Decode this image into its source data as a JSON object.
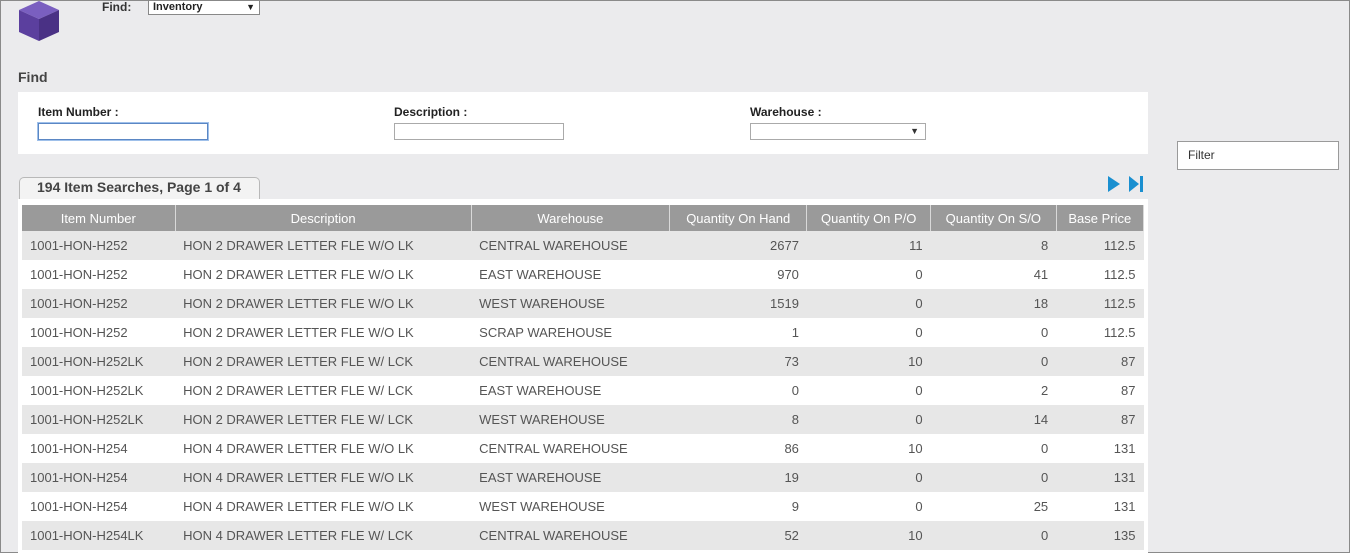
{
  "header": {
    "find_label": "Find:",
    "find_select": "Inventory"
  },
  "section": {
    "title": "Find"
  },
  "form": {
    "item_number_label": "Item Number :",
    "item_number_value": "",
    "description_label": "Description :",
    "description_value": "",
    "warehouse_label": "Warehouse :",
    "warehouse_value": ""
  },
  "filter": {
    "label": "Filter"
  },
  "results": {
    "tab_label": "194 Item Searches, Page 1 of 4",
    "columns": [
      "Item Number",
      "Description",
      "Warehouse",
      "Quantity On Hand",
      "Quantity On P/O",
      "Quantity On S/O",
      "Base Price"
    ],
    "rows": [
      [
        "1001-HON-H252",
        "HON 2 DRAWER LETTER FLE W/O LK",
        "CENTRAL WAREHOUSE",
        "2677",
        "11",
        "8",
        "112.5"
      ],
      [
        "1001-HON-H252",
        "HON 2 DRAWER LETTER FLE W/O LK",
        "EAST WAREHOUSE",
        "970",
        "0",
        "41",
        "112.5"
      ],
      [
        "1001-HON-H252",
        "HON 2 DRAWER LETTER FLE W/O LK",
        "WEST WAREHOUSE",
        "1519",
        "0",
        "18",
        "112.5"
      ],
      [
        "1001-HON-H252",
        "HON 2 DRAWER LETTER FLE W/O LK",
        "SCRAP WAREHOUSE",
        "1",
        "0",
        "0",
        "112.5"
      ],
      [
        "1001-HON-H252LK",
        "HON 2 DRAWER LETTER FLE W/ LCK",
        "CENTRAL WAREHOUSE",
        "73",
        "10",
        "0",
        "87"
      ],
      [
        "1001-HON-H252LK",
        "HON 2 DRAWER LETTER FLE W/ LCK",
        "EAST WAREHOUSE",
        "0",
        "0",
        "2",
        "87"
      ],
      [
        "1001-HON-H252LK",
        "HON 2 DRAWER LETTER FLE W/ LCK",
        "WEST WAREHOUSE",
        "8",
        "0",
        "14",
        "87"
      ],
      [
        "1001-HON-H254",
        "HON 4 DRAWER LETTER FLE W/O LK",
        "CENTRAL WAREHOUSE",
        "86",
        "10",
        "0",
        "131"
      ],
      [
        "1001-HON-H254",
        "HON 4 DRAWER LETTER FLE W/O LK",
        "EAST WAREHOUSE",
        "19",
        "0",
        "0",
        "131"
      ],
      [
        "1001-HON-H254",
        "HON 4 DRAWER LETTER FLE W/O LK",
        "WEST WAREHOUSE",
        "9",
        "0",
        "25",
        "131"
      ],
      [
        "1001-HON-H254LK",
        "HON 4 DRAWER LETTER FLE W/ LCK",
        "CENTRAL WAREHOUSE",
        "52",
        "10",
        "0",
        "135"
      ]
    ]
  },
  "icons": {
    "logo": "cube-icon",
    "next": "next-page-icon",
    "last": "last-page-icon",
    "dropdown": "dropdown-arrow-icon"
  },
  "colors": {
    "accent": "#1a8fd0",
    "logo": "#5b3f9e",
    "header_bg": "#9a9a9a",
    "stripe": "#e7e7e7"
  }
}
